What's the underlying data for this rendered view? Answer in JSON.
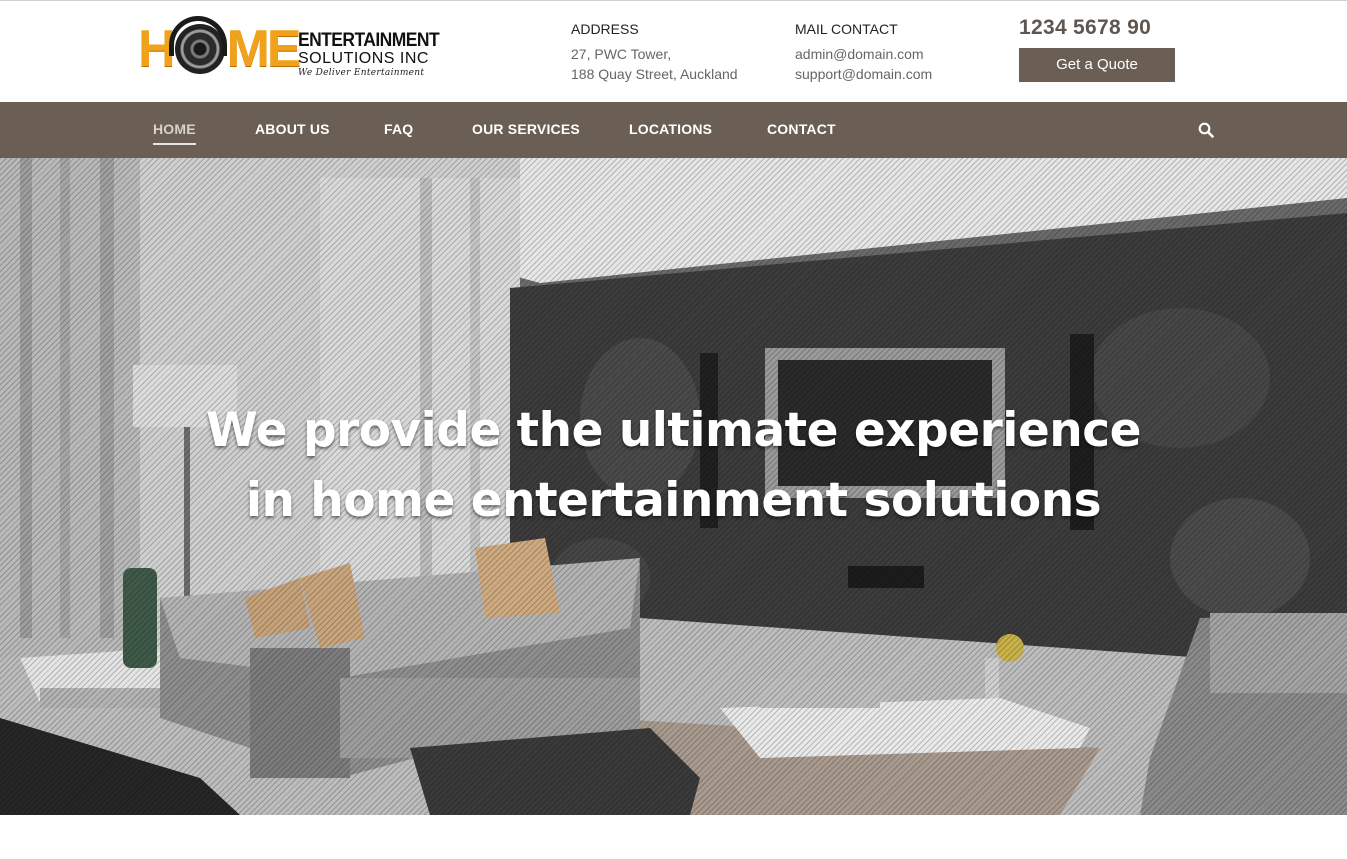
{
  "logo": {
    "home_letters": [
      "H",
      "ME"
    ],
    "line1": "ENTERTAINMENT",
    "line2": "SOLUTIONS INC",
    "tagline": "We Deliver Entertainment",
    "accent_color": "#f0a21c"
  },
  "address": {
    "title": "ADDRESS",
    "line1": "27, PWC Tower,",
    "line2": "188 Quay Street, Auckland"
  },
  "mail": {
    "title": "MAIL CONTACT",
    "line1": "admin@domain.com",
    "line2": "support@domain.com"
  },
  "phone": "1234 5678 90",
  "quote_button": "Get a Quote",
  "nav": {
    "items": [
      {
        "label": "HOME",
        "active": true
      },
      {
        "label": "ABOUT US",
        "active": false
      },
      {
        "label": "FAQ",
        "active": false
      },
      {
        "label": "OUR SERVICES",
        "active": false
      },
      {
        "label": "LOCATIONS",
        "active": false
      },
      {
        "label": "CONTACT",
        "active": false
      }
    ],
    "search_icon": "search-icon",
    "bar_color": "#6b5f55"
  },
  "hero": {
    "headline_line1": "We provide the ultimate experience",
    "headline_line2": "in home entertainment solutions"
  }
}
